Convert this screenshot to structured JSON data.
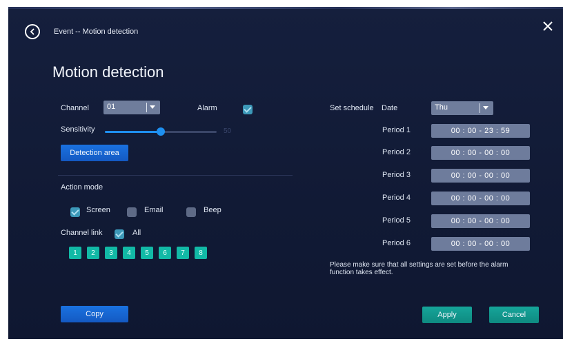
{
  "header": {
    "breadcrumb": "Event -- Motion detection",
    "title": "Motion detection"
  },
  "channel": {
    "label": "Channel",
    "value": "01"
  },
  "alarm": {
    "label": "Alarm",
    "checked": true
  },
  "sensitivity": {
    "label": "Sensitivity",
    "value": "50",
    "level_percent": 50
  },
  "detection_area_button": "Detection area",
  "action_mode": {
    "label": "Action mode",
    "options": [
      {
        "label": "Screen",
        "checked": true
      },
      {
        "label": "Email",
        "checked": false
      },
      {
        "label": "Beep",
        "checked": false
      }
    ]
  },
  "channel_link": {
    "label": "Channel link",
    "all_label": "All",
    "all_checked": true,
    "channels": [
      "1",
      "2",
      "3",
      "4",
      "5",
      "6",
      "7",
      "8"
    ]
  },
  "schedule": {
    "label": "Set schedule",
    "date_label": "Date",
    "date_value": "Thu",
    "periods": [
      {
        "label": "Period 1",
        "time": "00 : 00 - 23 : 59"
      },
      {
        "label": "Period 2",
        "time": "00 : 00 - 00 : 00"
      },
      {
        "label": "Period 3",
        "time": "00 : 00 - 00 : 00"
      },
      {
        "label": "Period 4",
        "time": "00 : 00 - 00 : 00"
      },
      {
        "label": "Period 5",
        "time": "00 : 00 - 00 : 00"
      },
      {
        "label": "Period 6",
        "time": "00 : 00 - 00 : 00"
      }
    ],
    "note": "Please make sure that all settings are set before the alarm function takes effect."
  },
  "footer": {
    "copy": "Copy",
    "apply": "Apply",
    "cancel": "Cancel"
  },
  "colors": {
    "accent_blue": "#1a72e0",
    "teal": "#16a59a",
    "background": "#131c39"
  }
}
